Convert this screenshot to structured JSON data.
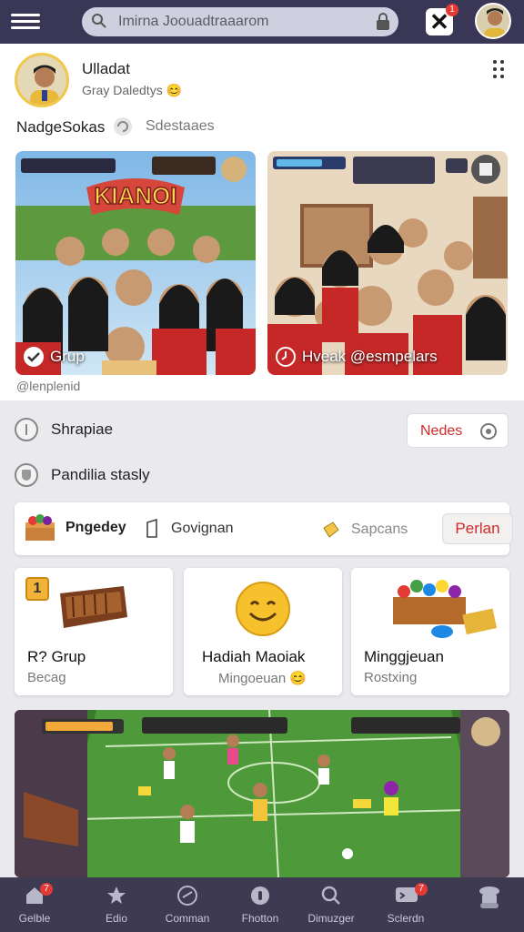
{
  "header": {
    "search_placeholder": "Imirna Joouadtraaarom",
    "notification_count": "1"
  },
  "post": {
    "author_name": "Ulladat",
    "author_sub": "Gray Daledtys",
    "tag_primary": "NadgeSokas",
    "tag_secondary": "Sdestaaes",
    "photo_left_title": "KIANOI",
    "photo_left_caption": "Grup",
    "photo_right_caption": "Hveak @esmpelars",
    "handle": "@lenplenid"
  },
  "rows": {
    "row1_label": "Shrapiae",
    "row1_button": "Nedes",
    "row2_label": "Pandilia stasly"
  },
  "actions": {
    "a1": "Pngedey",
    "a2": "Govignan",
    "a3": "Sapcans",
    "primary": "Perlan"
  },
  "tiles": [
    {
      "badge": "1",
      "title": "R? Grup",
      "sub": "Becag"
    },
    {
      "title": "Hadiah Maoiak",
      "sub": "Mingoeuan"
    },
    {
      "title": "Minggjeuan",
      "sub": "Rostxing"
    }
  ],
  "bottom_nav": [
    {
      "label": "Gelble",
      "badge": "7"
    },
    {
      "label": "Edio"
    },
    {
      "label": "Comman"
    },
    {
      "label": "Fhotton"
    },
    {
      "label": "Dimuzger"
    },
    {
      "label": "Sclerdn",
      "badge": "7"
    },
    {
      "label": ""
    }
  ],
  "colors": {
    "top_bar": "#3a3656",
    "accent_red": "#d12a2a",
    "bottom_nav": "#3d3a52"
  }
}
